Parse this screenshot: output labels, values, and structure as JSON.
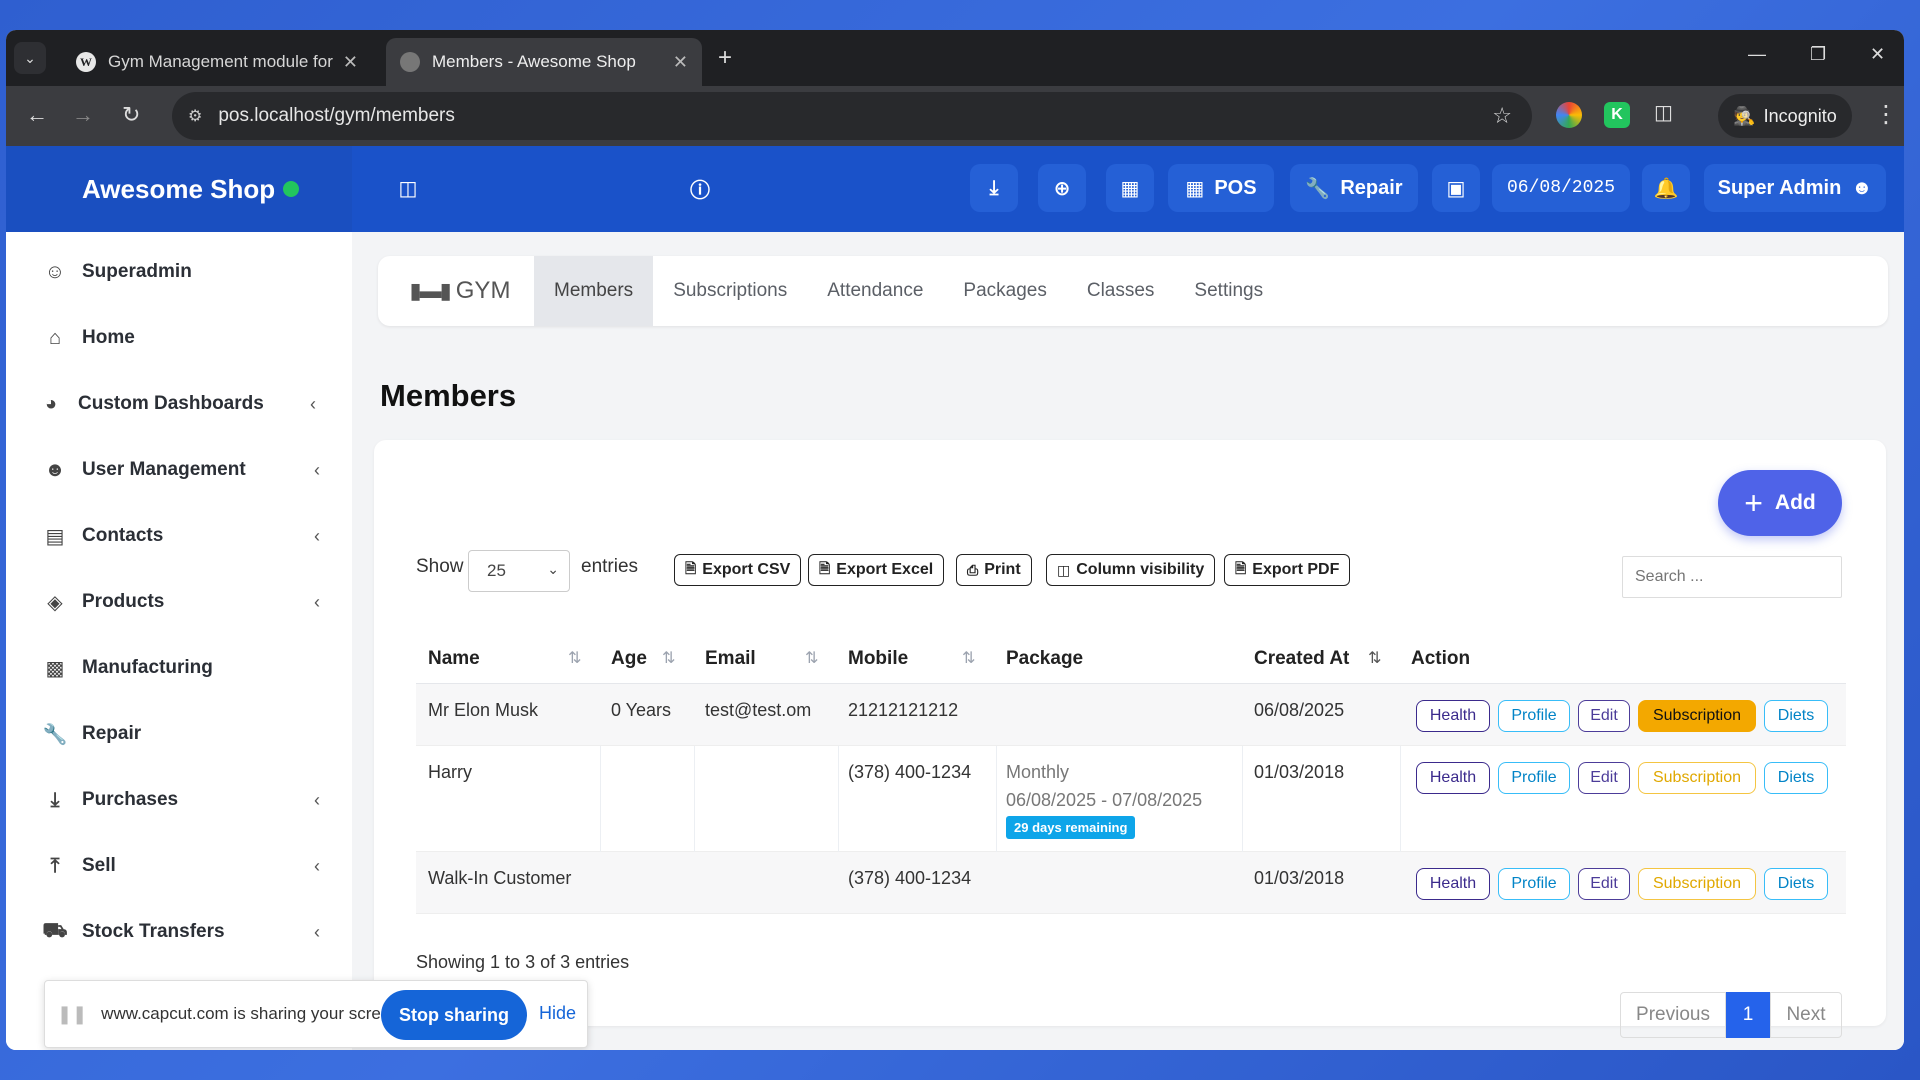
{
  "browser": {
    "tabs": [
      {
        "title": "Gym Management module for U",
        "favicon": "wordpress-icon"
      },
      {
        "title": "Members - Awesome Shop",
        "favicon": "globe-icon"
      }
    ],
    "url": "pos.localhost/gym/members",
    "incognito_label": "Incognito"
  },
  "appbar": {
    "brand": "Awesome Shop",
    "pos_label": "POS",
    "repair_label": "Repair",
    "date": "06/08/2025",
    "user": "Super Admin"
  },
  "sidebar": {
    "items": [
      {
        "label": "Superadmin",
        "icon": "user-cog-icon"
      },
      {
        "label": "Home",
        "icon": "home-icon"
      },
      {
        "label": "Custom Dashboards",
        "icon": "dashboard-icon"
      },
      {
        "label": "User Management",
        "icon": "users-icon"
      },
      {
        "label": "Contacts",
        "icon": "contacts-icon"
      },
      {
        "label": "Products",
        "icon": "box-icon"
      },
      {
        "label": "Manufacturing",
        "icon": "factory-icon"
      },
      {
        "label": "Repair",
        "icon": "wrench-icon"
      },
      {
        "label": "Purchases",
        "icon": "download-icon"
      },
      {
        "label": "Sell",
        "icon": "upload-icon"
      },
      {
        "label": "Stock Transfers",
        "icon": "truck-icon"
      }
    ]
  },
  "gymnav": {
    "logo": "GYM",
    "tabs": [
      "Members",
      "Subscriptions",
      "Attendance",
      "Packages",
      "Classes",
      "Settings"
    ]
  },
  "main": {
    "title": "Members",
    "add_label": "Add",
    "show_label": "Show",
    "entries_label": "entries",
    "page_length": "25",
    "export_buttons": [
      "Export CSV",
      "Export Excel",
      "Print",
      "Column visibility",
      "Export PDF"
    ],
    "search_placeholder": "Search ...",
    "columns": [
      "Name",
      "Age",
      "Email",
      "Mobile",
      "Package",
      "Created At",
      "Action"
    ],
    "rows": [
      {
        "name": "Mr Elon Musk",
        "age": "0 Years",
        "email": "test@test.om",
        "mobile": "21212121212",
        "package": "",
        "package_dates": "",
        "badge": "",
        "created": "06/08/2025"
      },
      {
        "name": "Harry",
        "age": "",
        "email": "",
        "mobile": "(378) 400-1234",
        "package": "Monthly",
        "package_dates": "06/08/2025 - 07/08/2025",
        "badge": "29 days remaining",
        "created": "01/03/2018"
      },
      {
        "name": "Walk-In Customer",
        "age": "",
        "email": "",
        "mobile": "(378) 400-1234",
        "package": "",
        "package_dates": "",
        "badge": "",
        "created": "01/03/2018"
      }
    ],
    "actions": [
      "Health",
      "Profile",
      "Edit",
      "Subscription",
      "Diets"
    ],
    "showing": "Showing 1 to 3 of 3 entries",
    "pager": {
      "prev": "Previous",
      "current": "1",
      "next": "Next"
    }
  },
  "share_banner": {
    "message": "www.capcut.com is sharing your screen.",
    "stop": "Stop sharing",
    "hide": "Hide"
  }
}
